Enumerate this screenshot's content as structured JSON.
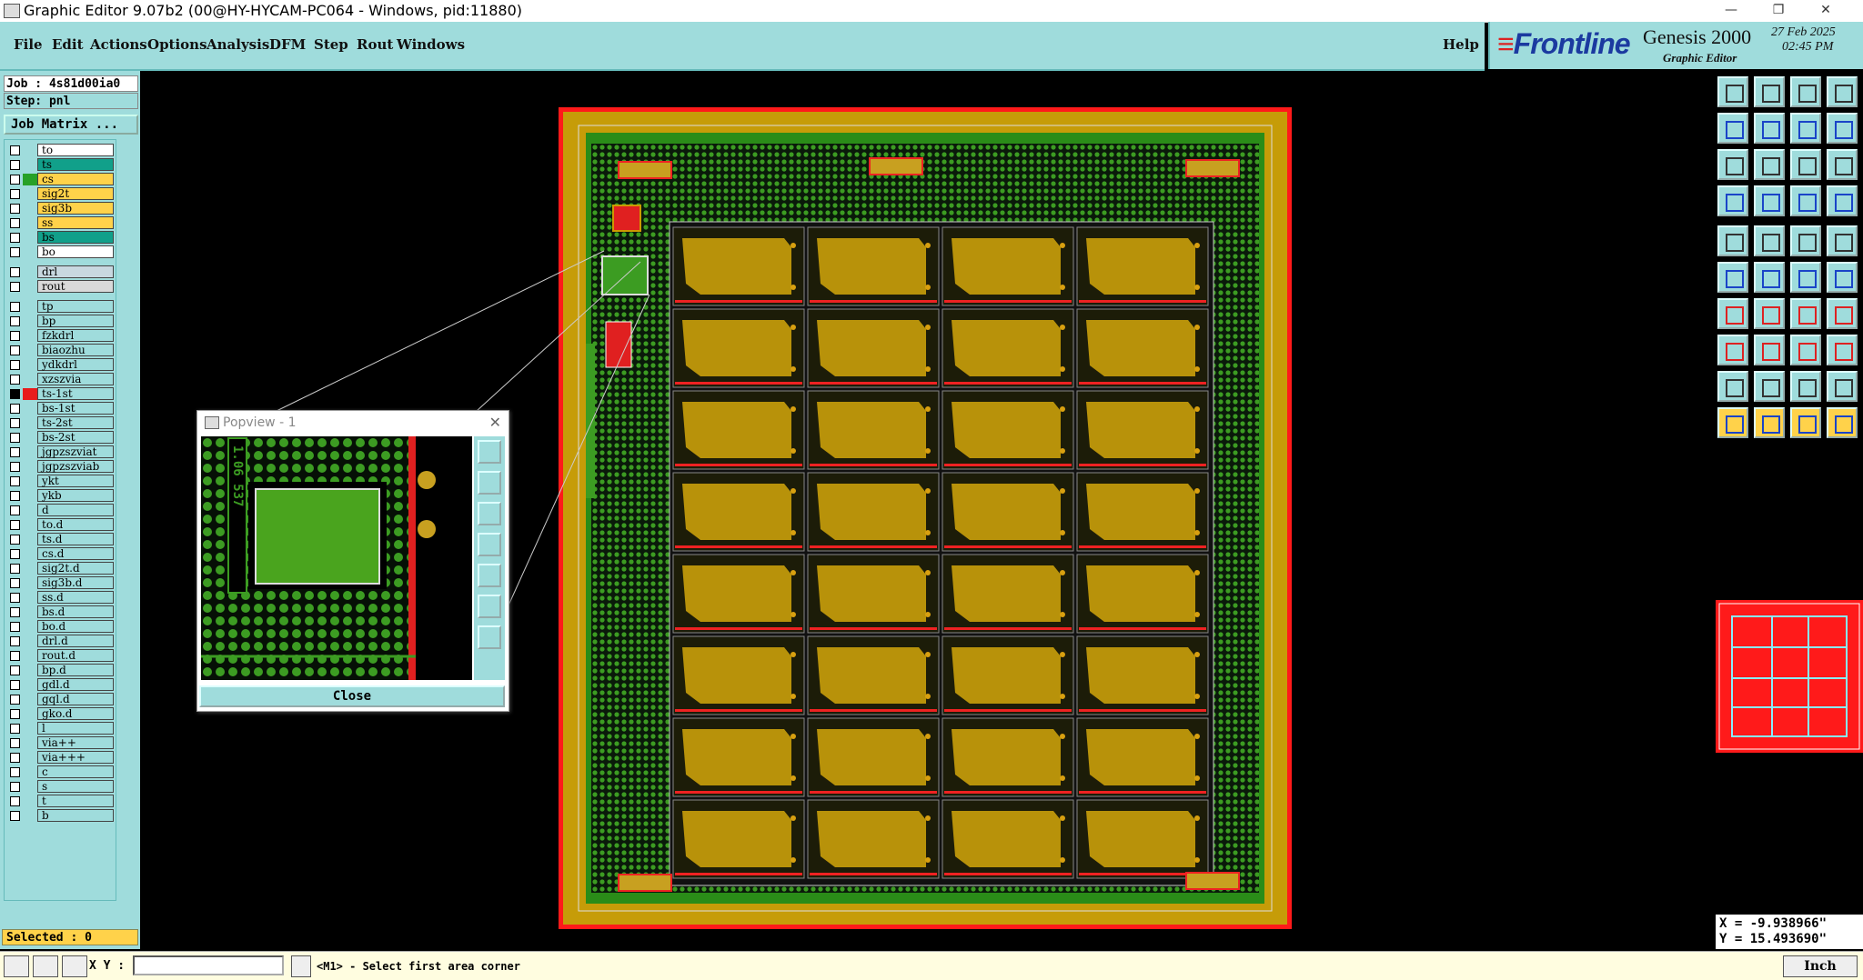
{
  "window": {
    "title": "Graphic Editor 9.07b2 (00@HY-HYCAM-PC064 - Windows, pid:11880)",
    "min_icon": "minimize-icon",
    "restore_icon": "restore-icon",
    "close_icon": "close-icon"
  },
  "menu": {
    "items": [
      "File",
      "Edit",
      "Actions",
      "Options",
      "Analysis",
      "DFM",
      "Step",
      "Rout",
      "Windows"
    ],
    "help": "Help"
  },
  "brand": {
    "logo_a": "Frontline",
    "product": "Genesis 2000",
    "subtitle": "Graphic Editor",
    "date": "27 Feb 2025",
    "time": "02:45 PM"
  },
  "job": {
    "job_line": "Job : 4s81d00ia0",
    "step_line": "Step: pnl",
    "matrix_button": "Job Matrix ..."
  },
  "layers": [
    {
      "name": "to",
      "color": "#ffffff",
      "swatch": ""
    },
    {
      "name": "ts",
      "color": "#11a08a",
      "swatch": ""
    },
    {
      "name": "cs",
      "color": "#ffd24a",
      "swatch": "#27a127"
    },
    {
      "name": "sig2t",
      "color": "#ffd24a",
      "swatch": ""
    },
    {
      "name": "sig3b",
      "color": "#ffd24a",
      "swatch": ""
    },
    {
      "name": "ss",
      "color": "#ffd24a",
      "swatch": ""
    },
    {
      "name": "bs",
      "color": "#11a08a",
      "swatch": ""
    },
    {
      "name": "bo",
      "color": "#ffffff",
      "swatch": ""
    },
    {
      "name": "drl",
      "color": "#c8d8e0",
      "swatch": ""
    },
    {
      "name": "rout",
      "color": "#d9d9d9",
      "swatch": ""
    },
    {
      "name": "tp",
      "color": "#9fdcdc",
      "swatch": ""
    },
    {
      "name": "bp",
      "color": "#9fdcdc",
      "swatch": ""
    },
    {
      "name": "fzkdrl",
      "color": "#9fdcdc",
      "swatch": ""
    },
    {
      "name": "biaozhu",
      "color": "#9fdcdc",
      "swatch": ""
    },
    {
      "name": "ydkdrl",
      "color": "#9fdcdc",
      "swatch": ""
    },
    {
      "name": "xzszvia",
      "color": "#9fdcdc",
      "swatch": ""
    },
    {
      "name": "ts-1st",
      "color": "#9fdcdc",
      "swatch": "#e81c1c"
    },
    {
      "name": "bs-1st",
      "color": "#9fdcdc",
      "swatch": ""
    },
    {
      "name": "ts-2st",
      "color": "#9fdcdc",
      "swatch": ""
    },
    {
      "name": "bs-2st",
      "color": "#9fdcdc",
      "swatch": ""
    },
    {
      "name": "jgpzszviat",
      "color": "#9fdcdc",
      "swatch": ""
    },
    {
      "name": "jgpzszviab",
      "color": "#9fdcdc",
      "swatch": ""
    },
    {
      "name": "ykt",
      "color": "#9fdcdc",
      "swatch": ""
    },
    {
      "name": "ykb",
      "color": "#9fdcdc",
      "swatch": ""
    },
    {
      "name": "d",
      "color": "#9fdcdc",
      "swatch": ""
    },
    {
      "name": "to.d",
      "color": "#9fdcdc",
      "swatch": ""
    },
    {
      "name": "ts.d",
      "color": "#9fdcdc",
      "swatch": ""
    },
    {
      "name": "cs.d",
      "color": "#9fdcdc",
      "swatch": ""
    },
    {
      "name": "sig2t.d",
      "color": "#9fdcdc",
      "swatch": ""
    },
    {
      "name": "sig3b.d",
      "color": "#9fdcdc",
      "swatch": ""
    },
    {
      "name": "ss.d",
      "color": "#9fdcdc",
      "swatch": ""
    },
    {
      "name": "bs.d",
      "color": "#9fdcdc",
      "swatch": ""
    },
    {
      "name": "bo.d",
      "color": "#9fdcdc",
      "swatch": ""
    },
    {
      "name": "drl.d",
      "color": "#9fdcdc",
      "swatch": ""
    },
    {
      "name": "rout.d",
      "color": "#9fdcdc",
      "swatch": ""
    },
    {
      "name": "bp.d",
      "color": "#9fdcdc",
      "swatch": ""
    },
    {
      "name": "gdl.d",
      "color": "#9fdcdc",
      "swatch": ""
    },
    {
      "name": "gql.d",
      "color": "#9fdcdc",
      "swatch": ""
    },
    {
      "name": "gko.d",
      "color": "#9fdcdc",
      "swatch": ""
    },
    {
      "name": "l",
      "color": "#9fdcdc",
      "swatch": ""
    },
    {
      "name": "via++",
      "color": "#9fdcdc",
      "swatch": ""
    },
    {
      "name": "via+++",
      "color": "#9fdcdc",
      "swatch": ""
    },
    {
      "name": "c",
      "color": "#9fdcdc",
      "swatch": ""
    },
    {
      "name": "s",
      "color": "#9fdcdc",
      "swatch": ""
    },
    {
      "name": "t",
      "color": "#9fdcdc",
      "swatch": ""
    },
    {
      "name": "b",
      "color": "#9fdcdc",
      "swatch": ""
    }
  ],
  "selected": "Selected : 0",
  "popview": {
    "title": "Popview - 1",
    "close": "Close",
    "label_text": "1.06 537"
  },
  "coords": {
    "x": "X = -9.938966\"",
    "y": "Y = 15.493690\""
  },
  "bottom": {
    "xy_label": "X Y :",
    "xy_value": "",
    "status": "<M1> - Select first area corner",
    "unit": "Inch"
  },
  "colors": {
    "panel": "#9fdcdc",
    "board_frame": "#ff1a1a",
    "board_copper": "#c69c08",
    "board_green": "#2a8c18",
    "unit_pad": "#b8920a"
  },
  "board": {
    "rows": 8,
    "cols": 4
  }
}
